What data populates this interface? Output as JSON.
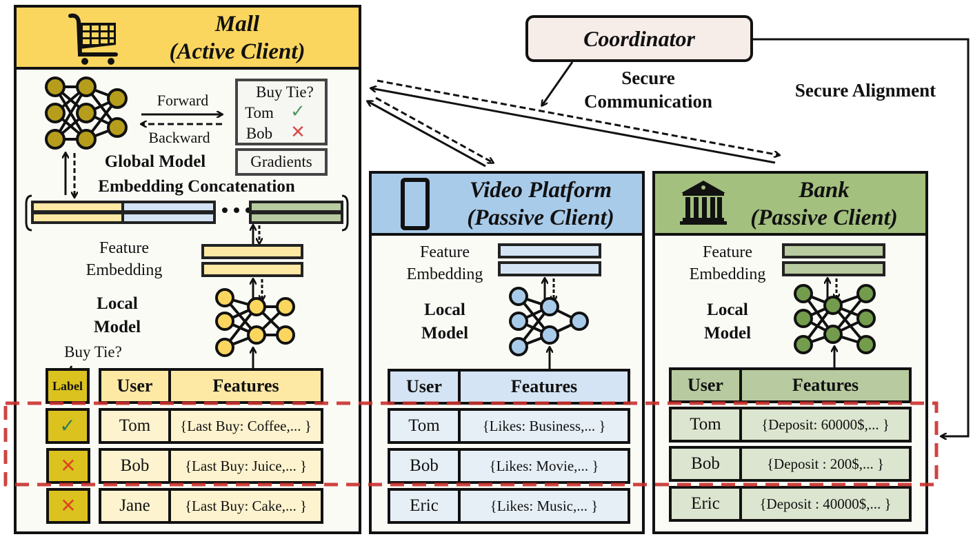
{
  "coordinator": {
    "title": "Coordinator",
    "secure_communication": [
      "Secure",
      "Communication"
    ],
    "secure_alignment": "Secure Alignment"
  },
  "mall": {
    "icon": "shopping-cart-icon",
    "title_line1": "Mall",
    "title_line2": "(Active Client)",
    "header_color": "#fbd65f",
    "forward": "Forward",
    "backward": "Backward",
    "label_box": {
      "question": "Buy Tie?",
      "rows": [
        {
          "name": "Tom",
          "mark": "check"
        },
        {
          "name": "Bob",
          "mark": "cross"
        }
      ]
    },
    "gradients": "Gradients",
    "global_model": "Global Model",
    "embedding_concat": "Embedding Concatenation",
    "feature_embedding": [
      "Feature",
      "Embedding"
    ],
    "local_model": [
      "Local",
      "Model"
    ],
    "buy_tie": "Buy Tie?",
    "table": {
      "label_header": "Label",
      "user_header": "User",
      "features_header": "Features",
      "rows": [
        {
          "label": "check",
          "user": "Tom",
          "features": "{Last Buy: Coffee,... }"
        },
        {
          "label": "cross",
          "user": "Bob",
          "features": "{Last Buy: Juice,... }"
        },
        {
          "label": "cross",
          "user": "Jane",
          "features": "{Last Buy: Cake,... }"
        }
      ]
    }
  },
  "video": {
    "icon": "smartphone-icon",
    "title_line1": "Video Platform",
    "title_line2": "(Passive Client)",
    "header_color": "#a9cbea",
    "feature_embedding": [
      "Feature",
      "Embedding"
    ],
    "local_model": [
      "Local",
      "Model"
    ],
    "table": {
      "user_header": "User",
      "features_header": "Features",
      "rows": [
        {
          "user": "Tom",
          "features": "{Likes: Business,... }"
        },
        {
          "user": "Bob",
          "features": "{Likes: Movie,... }"
        },
        {
          "user": "Eric",
          "features": "{Likes: Music,... }"
        }
      ]
    }
  },
  "bank": {
    "icon": "bank-building-icon",
    "title_line1": "Bank",
    "title_line2": "(Passive Client)",
    "header_color": "#a3c07f",
    "feature_embedding": [
      "Feature",
      "Embedding"
    ],
    "local_model": [
      "Local",
      "Model"
    ],
    "table": {
      "user_header": "User",
      "features_header": "Features",
      "rows": [
        {
          "user": "Tom",
          "features": "{Deposit: 60000$,... }"
        },
        {
          "user": "Bob",
          "features": "{Deposit : 200$,... }"
        },
        {
          "user": "Eric",
          "features": "{Deposit : 40000$,... }"
        }
      ]
    }
  },
  "colors": {
    "check": "#2e7d4f",
    "cross": "#d94a1f",
    "aligned_region": "#c9302c"
  }
}
